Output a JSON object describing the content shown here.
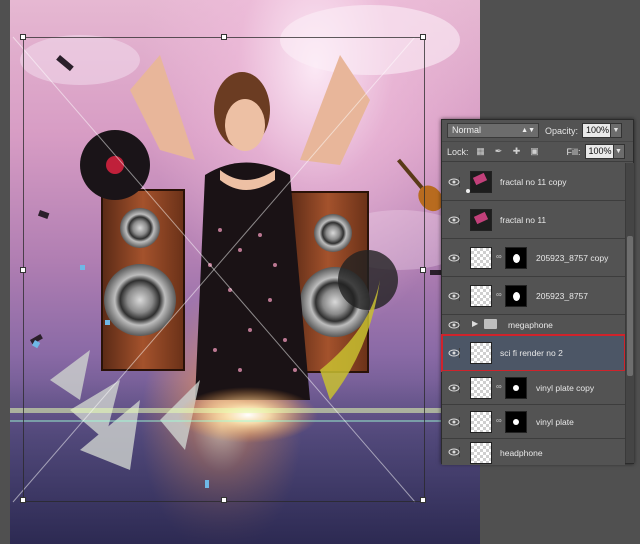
{
  "layers_panel": {
    "blend_mode": "Normal",
    "opacity_label": "Opacity:",
    "opacity_value": "100%",
    "lock_label": "Lock:",
    "fill_label": "Fill:",
    "fill_value": "100%",
    "layers": [
      {
        "name": "fractal no 11 copy",
        "type": "dark-thumb"
      },
      {
        "name": "fractal no 11",
        "type": "dark-thumb"
      },
      {
        "name": "205923_8757 copy",
        "type": "mask"
      },
      {
        "name": "205923_8757",
        "type": "mask"
      },
      {
        "name": "megaphone",
        "type": "group"
      },
      {
        "name": "sci fi render no 2",
        "type": "smart",
        "selected": true
      },
      {
        "name": "vinyl plate copy",
        "type": "mask"
      },
      {
        "name": "vinyl plate",
        "type": "mask"
      },
      {
        "name": "headphone",
        "type": "plain"
      }
    ]
  },
  "colors": {
    "selection_outline": "#d0232b",
    "panel_bg": "#535353"
  }
}
